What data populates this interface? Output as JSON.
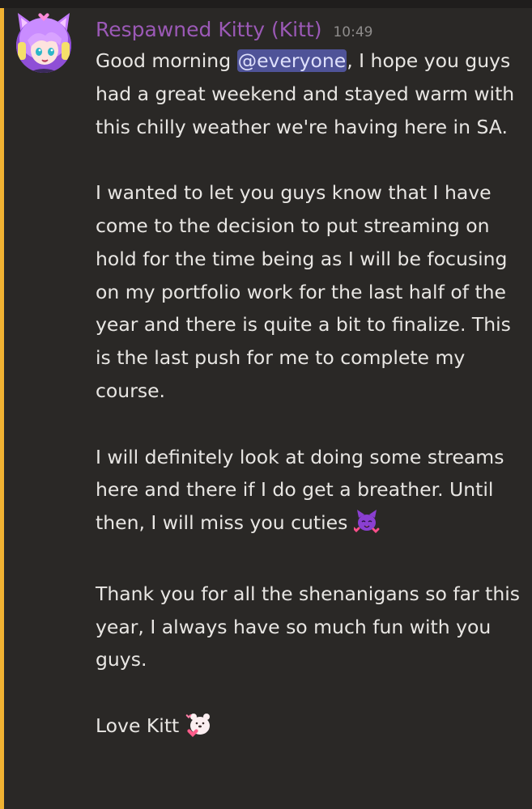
{
  "message": {
    "author": "Respawned Kitty (Kitt)",
    "timestamp": "10:49",
    "p1_before": "Good morning ",
    "mention": "@everyone",
    "p1_after": ", I hope you guys had a great weekend and stayed warm with this chilly weather we're having here in SA.",
    "p2": "I wanted to let you guys know that I have come to the decision to put streaming on hold for the time being as I will be focusing on my portfolio work for the last half of the year and there is quite a bit to finalize. This is the last push for me to complete my course.",
    "p3": "I will definitely look at doing some streams here and there if I do get a breather. Until then, I will miss you cuties",
    "p4": "Thank you for all the shenanigans so far this year, I always have so much fun with you guys.",
    "p5": "Love Kitt"
  },
  "colors": {
    "background": "#2a2826",
    "mention_bar": "#f0b232",
    "username": "#9b59b6",
    "mention_bg": "#4f5398",
    "text": "#e8e6e3",
    "timestamp": "#8e8c8b"
  },
  "icons": [
    "avatar-cat-girl",
    "purple-cat-hearts-emoji",
    "bear-hug-heart-emoji"
  ]
}
